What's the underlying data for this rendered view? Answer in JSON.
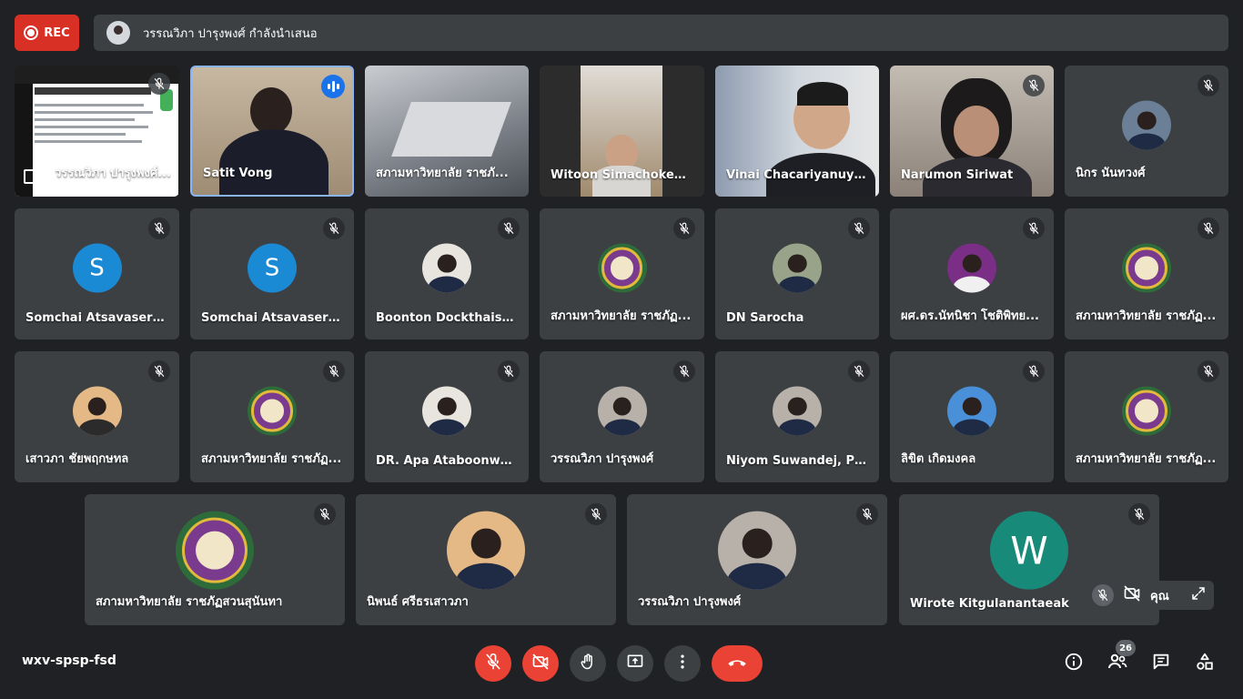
{
  "recording": {
    "label": "REC",
    "color": "#d93025"
  },
  "presenting_banner": {
    "text": "วรรณวิภา ปารุงพงศ์ กำลังนำเสนอ"
  },
  "tiles_row1": [
    {
      "name": "วรรณวิภา ปารุงพงศ์...",
      "kind": "screenshare"
    },
    {
      "name": "Satit Vong",
      "kind": "video",
      "speaking": true
    },
    {
      "name": "สภามหาวิทยาลัย ราชภั...",
      "kind": "video"
    },
    {
      "name": "Witoon Simachoked...",
      "kind": "video"
    },
    {
      "name": "Vinai Chacariyanuyok",
      "kind": "video"
    },
    {
      "name": "Narumon Siriwat",
      "kind": "video"
    },
    {
      "name": "นิกร นันทวงศ์",
      "kind": "avatar"
    }
  ],
  "tiles_row2": [
    {
      "name": "Somchai Atsavaseran...",
      "letter": "S"
    },
    {
      "name": "Somchai Atsavaseran...",
      "letter": "S"
    },
    {
      "name": "Boonton Dockthaisong"
    },
    {
      "name": "สภามหาวิทยาลัย ราชภัฏ..."
    },
    {
      "name": "DN Sarocha"
    },
    {
      "name": "ผศ.ดร.นัทนิชา โชติพิทย..."
    },
    {
      "name": "สภามหาวิทยาลัย ราชภัฏ..."
    }
  ],
  "tiles_row3": [
    {
      "name": "เสาวภา ชัยพฤกษทล"
    },
    {
      "name": "สภามหาวิทยาลัย ราชภัฏ..."
    },
    {
      "name": "DR. Apa Ataboonwon..."
    },
    {
      "name": "วรรณวิภา ปารุงพงศ์"
    },
    {
      "name": "Niyom Suwandej, Ph.D."
    },
    {
      "name": "ลิขิต เกิดมงคล"
    },
    {
      "name": "สภามหาวิทยาลัย ราชภัฏ..."
    }
  ],
  "tiles_row4": [
    {
      "name": "สภามหาวิทยาลัย ราชภัฏสวนสุนันทา"
    },
    {
      "name": "นิพนธ์ ศรีธรเสาวภา"
    },
    {
      "name": "วรรณวิภา ปารุงพงศ์"
    },
    {
      "name": "Wirote Kitgulanantaeak",
      "letter": "W"
    }
  ],
  "self_view": {
    "label": "คุณ"
  },
  "meeting_code": "wxv-spsp-fsd",
  "participants_count": "26",
  "icons": {
    "mic_off": "mic-off-icon",
    "camera_off": "camera-off-icon",
    "raise_hand": "raise-hand-icon",
    "present": "present-screen-icon",
    "more": "more-vert-icon",
    "end_call": "call-end-icon",
    "info": "info-icon",
    "people": "people-icon",
    "chat": "chat-icon",
    "activities": "activities-icon",
    "expand": "expand-icon"
  },
  "colors": {
    "background": "#202124",
    "tile": "#3c4043",
    "danger": "#ea4335",
    "speaking": "#1a73e8",
    "avatar_blue": "#1a8ad4",
    "avatar_teal": "#188a7a"
  }
}
